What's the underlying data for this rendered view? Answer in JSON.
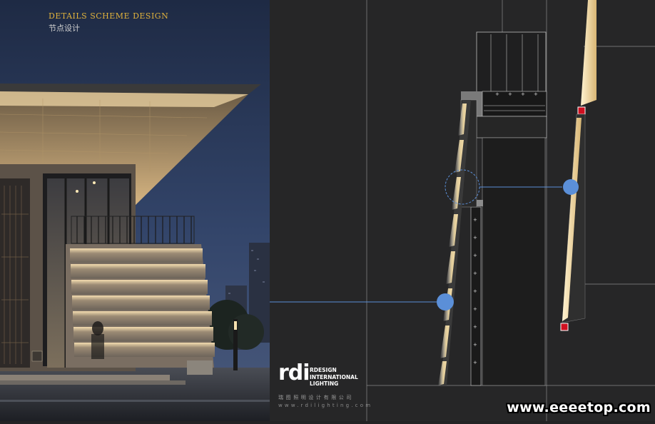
{
  "header": {
    "title_en": "DETAILS SCHEME DESIGN",
    "title_cn": "节点设计"
  },
  "logo": {
    "mark": "rdi",
    "line1": "RDESIGN",
    "line2": "INTERNATIONAL",
    "line3": "LIGHTING",
    "company_cn": "瑞图照明设计有限公司",
    "website": "www.rdilighting.com"
  },
  "watermark": "www.eeeetop.com",
  "colors": {
    "accent_gold": "#e0b23c",
    "callout_blue": "#5b8fd8",
    "marker_red": "#d01020",
    "light_glow": "#f3dca6",
    "drawing_bg": "#262627"
  }
}
